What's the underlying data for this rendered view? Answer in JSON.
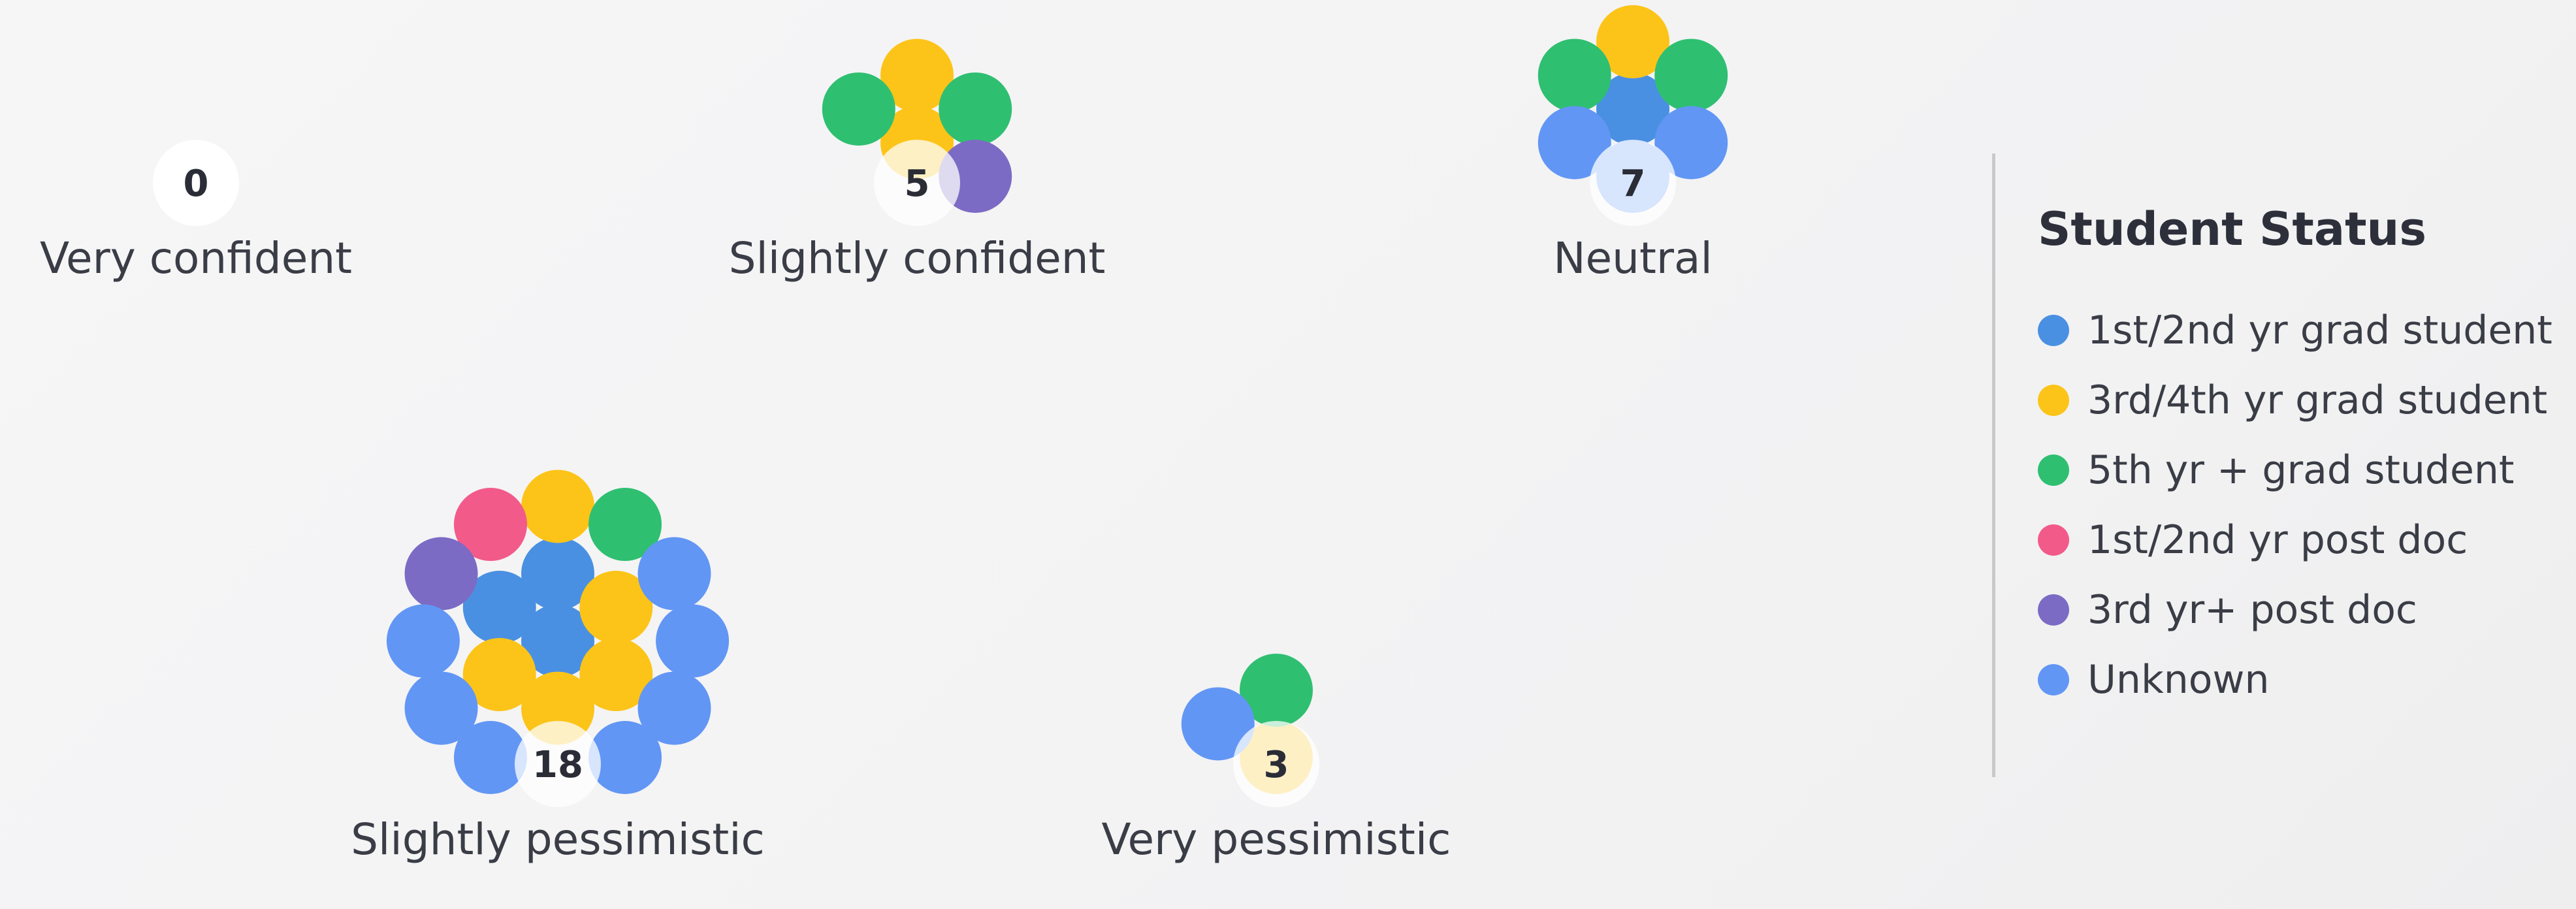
{
  "chart_data": {
    "type": "bubble-cluster",
    "groups": [
      {
        "label": "Very confident",
        "count": "0",
        "counts": {
          "1st/2nd yr grad student": 0,
          "3rd/4th yr grad student": 0,
          "5th yr + grad student": 0,
          "1st/2nd yr post doc": 0,
          "3rd yr+ post doc": 0,
          "Unknown": 0
        }
      },
      {
        "label": "Slightly confident",
        "count": "5",
        "counts": {
          "1st/2nd yr grad student": 0,
          "3rd/4th yr grad student": 2,
          "5th yr + grad student": 2,
          "1st/2nd yr post doc": 0,
          "3rd yr+ post doc": 1,
          "Unknown": 0
        }
      },
      {
        "label": "Neutral",
        "count": "7",
        "counts": {
          "1st/2nd yr grad student": 1,
          "3rd/4th yr grad student": 1,
          "5th yr + grad student": 2,
          "1st/2nd yr post doc": 0,
          "3rd yr+ post doc": 0,
          "Unknown": 3
        }
      },
      {
        "label": "Slightly pessimistic",
        "count": "18",
        "counts": {
          "1st/2nd yr grad student": 3,
          "3rd/4th yr grad student": 5,
          "5th yr + grad student": 1,
          "1st/2nd yr post doc": 1,
          "3rd yr+ post doc": 1,
          "Unknown": 7
        }
      },
      {
        "label": "Very pessimistic",
        "count": "3",
        "counts": {
          "1st/2nd yr grad student": 0,
          "3rd/4th yr grad student": 1,
          "5th yr + grad student": 1,
          "1st/2nd yr post doc": 0,
          "3rd yr+ post doc": 0,
          "Unknown": 1
        }
      }
    ],
    "legend": {
      "title": "Student Status",
      "placement": "right",
      "items": [
        {
          "label": "1st/2nd yr grad student",
          "color": "#4a90e2"
        },
        {
          "label": "3rd/4th yr grad student",
          "color": "#fcc419"
        },
        {
          "label": "5th yr + grad student",
          "color": "#2fbf71"
        },
        {
          "label": "1st/2nd yr post doc",
          "color": "#f25a8a"
        },
        {
          "label": "3rd yr+ post doc",
          "color": "#7c6bc4"
        },
        {
          "label": "Unknown",
          "color": "#6296f5"
        }
      ]
    }
  }
}
